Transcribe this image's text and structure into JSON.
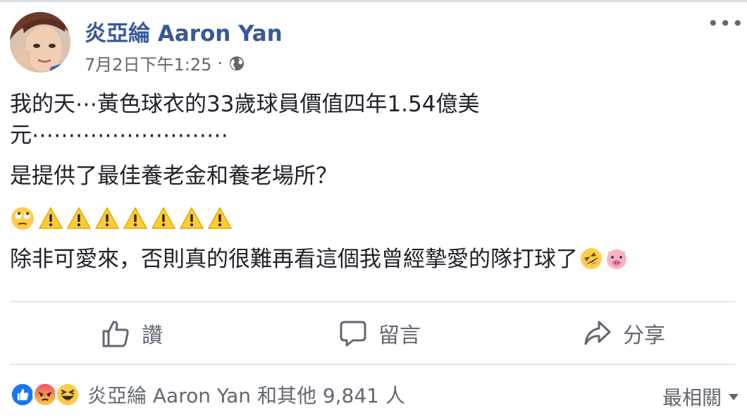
{
  "post": {
    "author": "炎亞綸 Aaron Yan",
    "date": "7月2日下午1:25",
    "separator": "·",
    "privacy_icon": "globe-icon",
    "more_icon": "more-options-icon",
    "more_glyph": "•••"
  },
  "content": {
    "line1": "我的天⋯黃色球衣的33歲球員價值四年1.54億美",
    "line2": "元⋯⋯⋯⋯⋯⋯⋯⋯⋯",
    "line3": "是提供了最佳養老金和養老場所？",
    "emoji_row": [
      "rolling-eyes-emoji",
      "warning-emoji",
      "warning-emoji",
      "warning-emoji",
      "warning-emoji",
      "warning-emoji",
      "warning-emoji",
      "warning-emoji"
    ],
    "line4": "除非可愛來，否則真的很難再看這個我曾經摯愛的隊打球了",
    "line4_emojis": [
      "rolling-laughing-emoji",
      "pig-emoji"
    ]
  },
  "actions": {
    "like": "讚",
    "comment": "留言",
    "share": "分享"
  },
  "reactions": {
    "icons": [
      "like-reaction",
      "angry-reaction",
      "haha-reaction"
    ],
    "text": "炎亞綸 Aaron Yan 和其他 9,841 人",
    "sort_label": "最相關"
  },
  "colors": {
    "author": "#365899",
    "text": "#1d2129",
    "secondary": "#616770",
    "like_blue": "#1877f2",
    "warning_yellow": "#ffcc33"
  }
}
